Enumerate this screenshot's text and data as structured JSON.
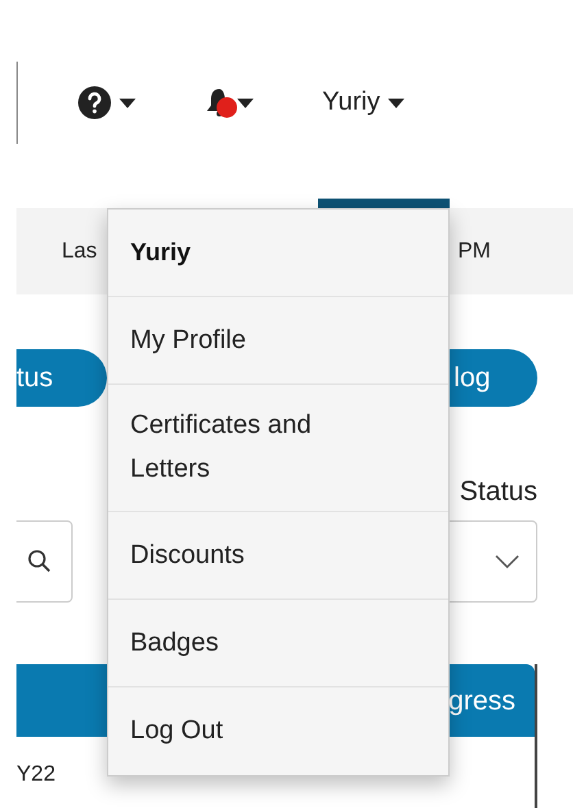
{
  "header": {
    "notifications": {
      "unread": true
    },
    "user_menu": {
      "label": "Yuriy",
      "open": true
    }
  },
  "info_bar": {
    "left_text": "Las",
    "right_text": "PM"
  },
  "buttons": [
    "tus",
    "log"
  ],
  "filters": {
    "status_label": "Status"
  },
  "table": {
    "header_right": "gress",
    "rows": [
      "Y22"
    ]
  },
  "user_dropdown": [
    {
      "kind": "header",
      "label": "Yuriy"
    },
    {
      "kind": "link",
      "label": "My Profile"
    },
    {
      "kind": "link",
      "label": "Certificates and Letters"
    },
    {
      "kind": "link",
      "label": "Discounts"
    },
    {
      "kind": "link",
      "label": "Badges"
    },
    {
      "kind": "link",
      "label": "Log Out"
    }
  ]
}
